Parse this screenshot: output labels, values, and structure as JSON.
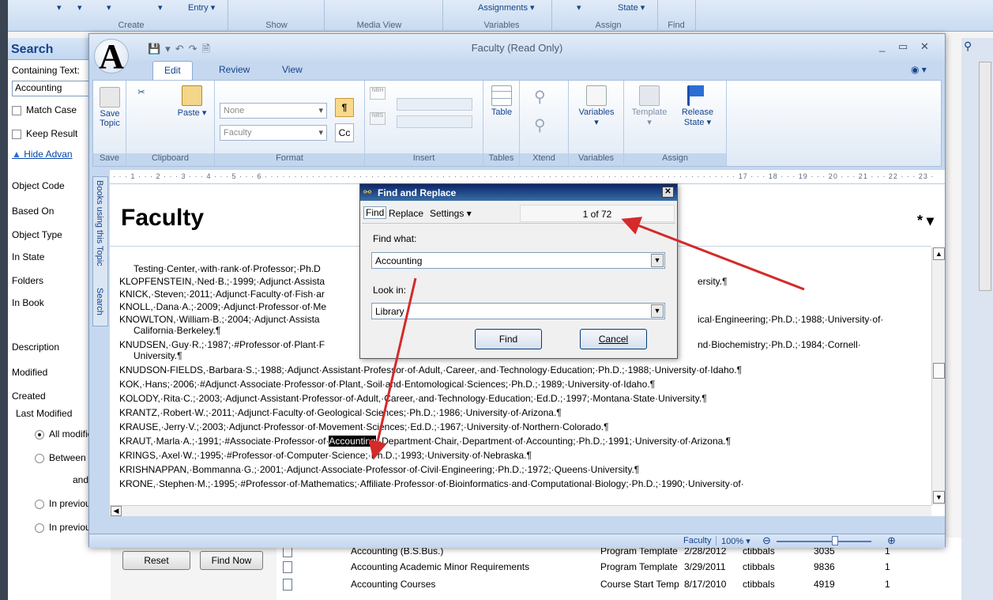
{
  "top_ribbon": {
    "items": [
      "Entry ▾",
      "Assignments ▾",
      "State ▾"
    ],
    "groups": [
      "Create",
      "Show",
      "Media View",
      "Variables",
      "Assign",
      "Find"
    ]
  },
  "search_panel": {
    "title": "Search",
    "containing_text_label": "Containing Text:",
    "containing_text_value": "Accounting",
    "match_case": "Match Case",
    "keep_results": "Keep Result",
    "hide_advanced": "Hide Advan",
    "fields": [
      "Object Code",
      "Based On",
      "Object Type",
      "In State",
      "Folders",
      "In Book",
      "Description",
      "Modified",
      "Created"
    ],
    "last_modified_label": "Last Modified",
    "radios": [
      "All modifie",
      "Between",
      "and",
      "In previou",
      "In previou"
    ],
    "reset": "Reset",
    "find_now": "Find Now"
  },
  "results": [
    {
      "name": "Accounting (B.S.Bus.)",
      "type": "Program Template",
      "date": "2/28/2012",
      "user": "ctibbals",
      "id": "3035",
      "count": "1"
    },
    {
      "name": "Accounting Academic Minor Requirements",
      "type": "Program Template",
      "date": "3/29/2011",
      "user": "ctibbals",
      "id": "9836",
      "count": "1"
    },
    {
      "name": "Accounting Courses",
      "type": "Course Start Temp",
      "date": "8/17/2010",
      "user": "ctibbals",
      "id": "4919",
      "count": "1"
    }
  ],
  "faculty_window": {
    "title": "Faculty (Read Only)",
    "tabs": [
      "Edit",
      "Review",
      "View"
    ],
    "ribbon": {
      "save_topic": "Save Topic",
      "paste": "Paste",
      "style_combo": "None",
      "para_combo": "Faculty",
      "table": "Table",
      "variables": "Variables",
      "template": "Template",
      "release_state": "Release State ▾",
      "groups": [
        "Save",
        "Clipboard",
        "Format",
        "Insert",
        "Tables",
        "Xtend",
        "Variables",
        "Assign"
      ]
    },
    "side_tabs": [
      "Books using this Topic",
      "Search"
    ],
    "ruler": "· · · 1 · · · 2 · · · 3 · · · 4 · · · 5 · · · 6 · · · · · · · · · · · · · · · · · · · · · · · · · · · · · · · · · · · · · · · · · · · · · · · · · · · · · · · · · · · · · · · · · · · · · · · · · · · · · · · · 17 · · · 18 · · · 19 · · · 20 · · · 21 · · · 22 · · · 23 ·",
    "doc_title": "Faculty",
    "doc_star": "*",
    "lines": [
      {
        "pre": "Testing·Center,·with·rank·of·Professor;·Ph.D",
        "hl": "",
        "post": "",
        "indent": true
      },
      {
        "pre": "KLOPFENSTEIN,·Ned·B.;·1999;·Adjunct·Assista",
        "hl": "",
        "post": "",
        "tail": "ersity.¶"
      },
      {
        "pre": "KNICK,·Steven;·2011;·Adjunct·Faculty·of·Fish·ar",
        "hl": "",
        "post": ""
      },
      {
        "pre": "KNOLL,·Dana·A.;·2009;·Adjunct·Professor·of·Me",
        "hl": "",
        "post": ""
      },
      {
        "pre": "KNOWLTON,·William·B.;·2004;·Adjunct·Assista",
        "hl": "",
        "post": "",
        "tail": "ical·Engineering;·Ph.D.;·1988;·University·of·"
      },
      {
        "pre": "California·Berkeley.¶",
        "hl": "",
        "post": "",
        "indent": true
      },
      {
        "pre": "KNUDSEN,·Guy·R.;·1987;·#Professor·of·Plant·F",
        "hl": "",
        "post": "",
        "tail": "nd·Biochemistry;·Ph.D.;·1984;·Cornell·"
      },
      {
        "pre": "University.¶",
        "hl": "",
        "post": "",
        "indent": true
      },
      {
        "pre": "KNUDSON-FIELDS,·Barbara·S.;·1988;·Adjunct·Assistant·Professor·of·Adult,·Career,·and·Technology·Education;·Ph.D.;·1988;·University·of·Idaho.¶",
        "hl": "",
        "post": ""
      },
      {
        "pre": "KOK,·Hans;·2006;·#Adjunct·Associate·Professor·of·Plant,·Soil·and·Entomological·Sciences;·Ph.D.;·1989;·University·of·Idaho.¶",
        "hl": "",
        "post": ""
      },
      {
        "pre": "KOLODY,·Rita·C.;·2003;·Adjunct·Assistant·Professor·of·Adult,·Career,·and·Technology·Education;·Ed.D.;·1997;·Montana·State·University.¶",
        "hl": "",
        "post": ""
      },
      {
        "pre": "KRANTZ,·Robert·W.;·2011;·Adjunct·Faculty·of·Geological·Sciences;·Ph.D.;·1986;·University·of·Arizona.¶",
        "hl": "",
        "post": ""
      },
      {
        "pre": "KRAUSE,·Jerry·V.;·2003;·Adjunct·Professor·of·Movement·Sciences;·Ed.D.;·1967;·University·of·Northern·Colorado.¶",
        "hl": "",
        "post": ""
      },
      {
        "pre": "KRAUT,·Marla·A.;·1991;·#Associate·Professor·of·",
        "hl": "Accounting",
        "post": ",·Department·Chair,·Department·of·Accounting;·Ph.D.;·1991;·University·of·Arizona.¶"
      },
      {
        "pre": "KRINGS,·Axel·W.;·1995;·#Professor·of·Computer·Science;·Ph.D.;·1993;·University·of·Nebraska.¶",
        "hl": "",
        "post": ""
      },
      {
        "pre": "KRISHNAPPAN,·Bommanna·G.;·2001;·Adjunct·Associate·Professor·of·Civil·Engineering;·Ph.D.;·1972;·Queens·University.¶",
        "hl": "",
        "post": ""
      },
      {
        "pre": "KRONE,·Stephen·M.;·1995;·#Professor·of·Mathematics;·Affiliate·Professor·of·Bioinformatics·and·Computational·Biology;·Ph.D.;·1990;·University·of·",
        "hl": "",
        "post": ""
      }
    ],
    "status_topic": "Faculty",
    "zoom": "100%"
  },
  "find_dialog": {
    "title": "Find and Replace",
    "tabs": [
      "Find",
      "Replace",
      "Settings ▾"
    ],
    "count": "1 of 72",
    "find_what_label": "Find what:",
    "find_what_value": "Accounting",
    "look_in_label": "Look in:",
    "look_in_value": "Library",
    "find_button": "Find",
    "cancel_button": "Cancel"
  },
  "colors": {
    "arrow": "#d42a2a",
    "highlight": "#000000",
    "ribbon_blue": "#15428b"
  }
}
